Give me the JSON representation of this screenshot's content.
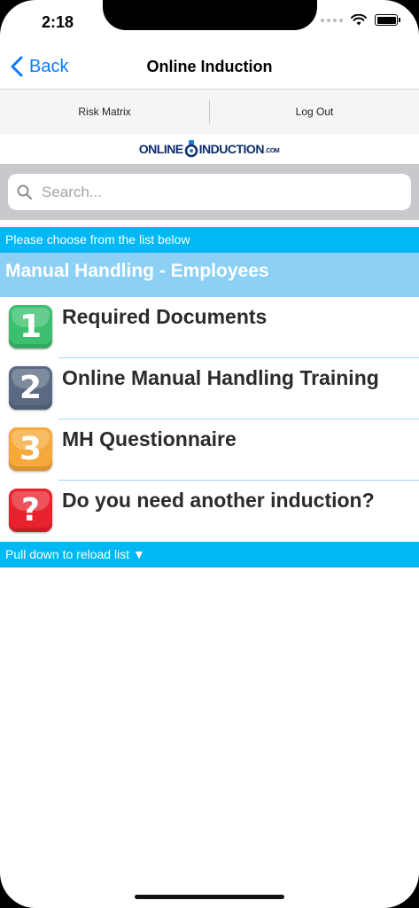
{
  "status_bar": {
    "time": "2:18"
  },
  "nav": {
    "back_label": "Back",
    "title": "Online Induction"
  },
  "toolbar": {
    "items": [
      {
        "label": "Risk Matrix"
      },
      {
        "label": "Log Out"
      }
    ]
  },
  "logo": {
    "text_a": "ONLINE",
    "text_b": "INDUCTION",
    "suffix": ".COM"
  },
  "search": {
    "placeholder": "Search..."
  },
  "info_text": "Please choose from the list below",
  "section_title": "Manual Handling - Employees",
  "list": {
    "items": [
      {
        "badge": "1",
        "label": "Required Documents",
        "color": "#3cbf6f"
      },
      {
        "badge": "2",
        "label": "Online Manual Handling Training",
        "color": "#5a6a82"
      },
      {
        "badge": "3",
        "label": "MH Questionnaire",
        "color": "#f7a83a"
      },
      {
        "badge": "?",
        "label": "Do you need another induction?",
        "color": "#e8232d"
      }
    ]
  },
  "footer": {
    "text": "Pull down to reload list ▼"
  },
  "colors": {
    "accent": "#0a7aff",
    "info_bar": "#00b8f4",
    "section_header": "#8dd0f6"
  }
}
